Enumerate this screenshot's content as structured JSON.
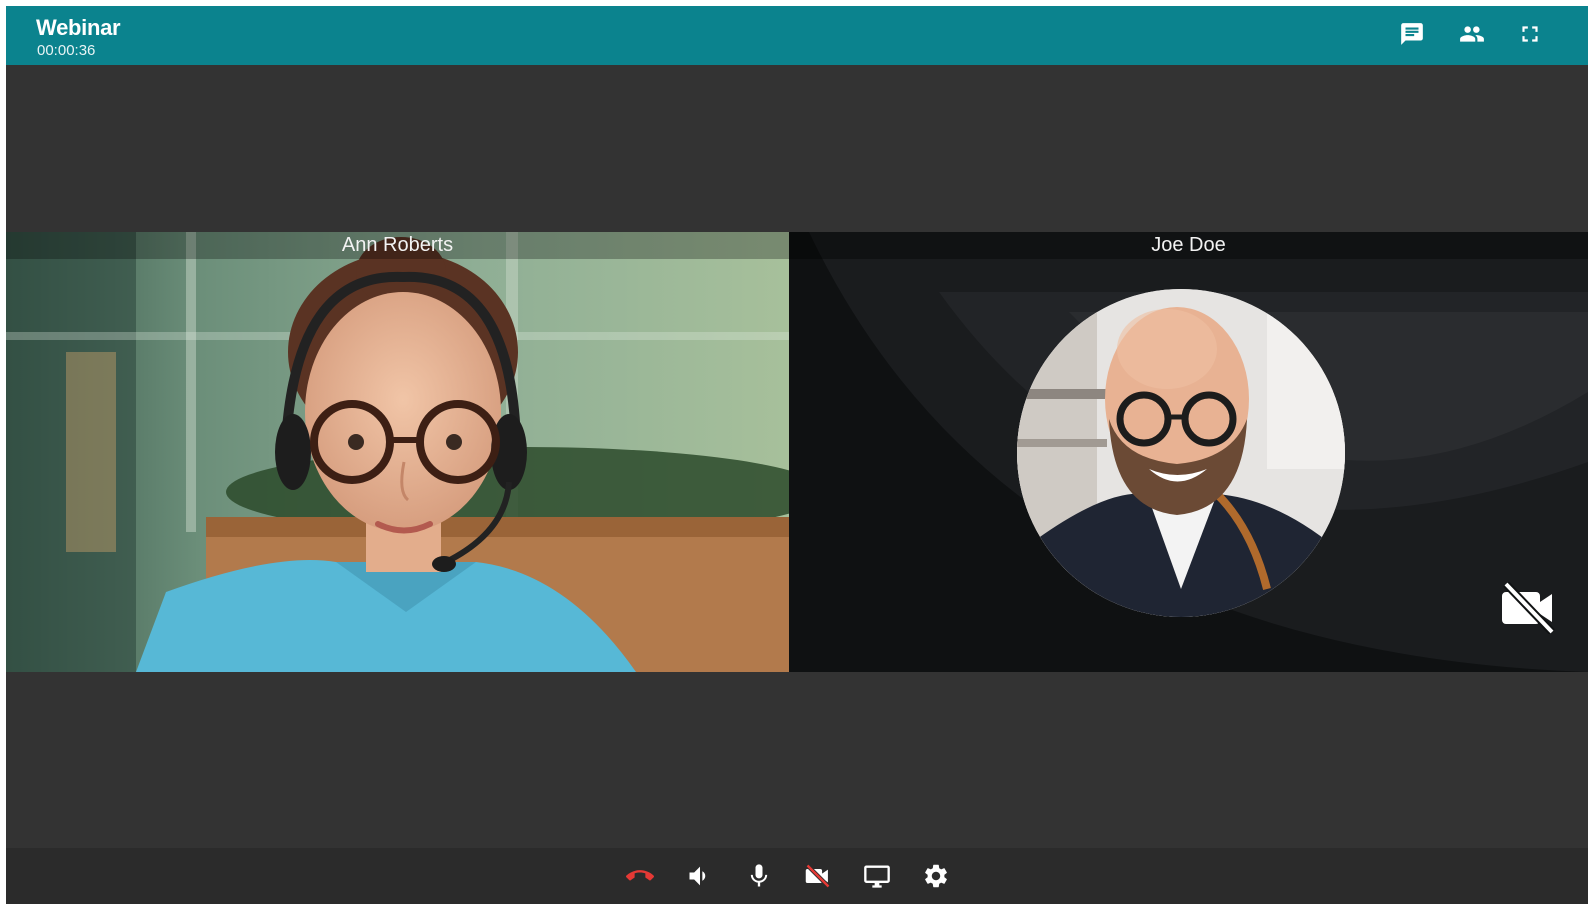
{
  "header": {
    "title": "Webinar",
    "timer": "00:00:36",
    "icons": [
      "chat-icon",
      "participants-icon",
      "fullscreen-icon"
    ]
  },
  "participants": [
    {
      "name": "Ann Roberts",
      "video": "on"
    },
    {
      "name": "Joe Doe",
      "video": "off",
      "status_icon": "video-off-icon"
    }
  ],
  "toolbar": {
    "icons": [
      "hang-up-icon",
      "speaker-icon",
      "microphone-icon",
      "camera-off-icon",
      "screen-share-icon",
      "settings-icon"
    ]
  },
  "colors": {
    "header_bg": "#0b838e",
    "stage_bg": "#333333",
    "toolbar_bg": "#2b2b2b",
    "hang_up": "#e53935",
    "icon": "#ffffff"
  }
}
